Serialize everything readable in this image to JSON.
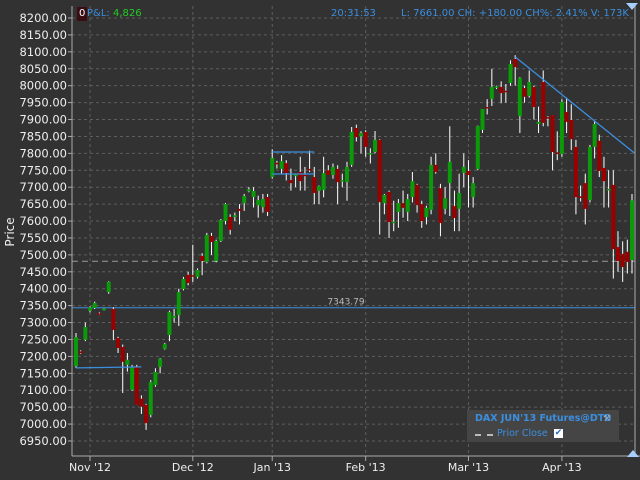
{
  "header": {
    "account_badge": "0",
    "pnl_label": "P&L:",
    "pnl_value": "4,826",
    "time": "20:31:53",
    "stats": "L: 7661.00 CH: +180.00 CH%: 2.41% V: 173K"
  },
  "legend": {
    "instrument": "DAX JUN'13 Futures@DTB",
    "prior_close_label": "Prior Close",
    "prior_close_checked": true
  },
  "colors": {
    "up": "#0a9a0a",
    "down": "#9a0000",
    "wick": "#ffffff",
    "line": "#3a8fe0",
    "background": "#323232",
    "accent_text": "#3a8fe0",
    "pnl": "#22cc22"
  },
  "chart_data": {
    "type": "candlestick",
    "ylabel": "Price",
    "ylim": [
      6925,
      8225
    ],
    "y_ticks": [
      "6950.00",
      "7000.00",
      "7050.00",
      "7100.00",
      "7150.00",
      "7200.00",
      "7250.00",
      "7300.00",
      "7350.00",
      "7400.00",
      "7450.00",
      "7500.00",
      "7550.00",
      "7600.00",
      "7650.00",
      "7700.00",
      "7750.00",
      "7800.00",
      "7850.00",
      "7900.00",
      "7950.00",
      "8000.00",
      "8050.00",
      "8100.00",
      "8150.00",
      "8200.00"
    ],
    "x_ticks": [
      {
        "label": "Nov '12",
        "at": 3
      },
      {
        "label": "Dec '12",
        "at": 25
      },
      {
        "label": "Jan '13",
        "at": 42
      },
      {
        "label": "Feb '13",
        "at": 62
      },
      {
        "label": "Mar '13",
        "at": 84
      },
      {
        "label": "Apr '13",
        "at": 104
      }
    ],
    "grid": true,
    "ohlc": [
      [
        7171,
        7269,
        7166,
        7257
      ],
      [
        7215,
        7218,
        7208,
        7210
      ],
      [
        7249,
        7300,
        7245,
        7287
      ],
      [
        7335,
        7348,
        7330,
        7345
      ],
      [
        7343,
        7362,
        7340,
        7358
      ],
      [
        7327,
        7330,
        7322,
        7324
      ],
      [
        7338,
        7342,
        7336,
        7341
      ],
      [
        7390,
        7422,
        7385,
        7420
      ],
      [
        7340,
        7345,
        7248,
        7278
      ],
      [
        7254,
        7258,
        7210,
        7225
      ],
      [
        7228,
        7235,
        7092,
        7184
      ],
      [
        7175,
        7210,
        7155,
        7190
      ],
      [
        7101,
        7175,
        7098,
        7169
      ],
      [
        7169,
        7175,
        7057,
        7057
      ],
      [
        7075,
        7085,
        7030,
        7051
      ],
      [
        7057,
        7060,
        6983,
        7003
      ],
      [
        7027,
        7130,
        7020,
        7124
      ],
      [
        7115,
        7165,
        7110,
        7154
      ],
      [
        7169,
        7195,
        7150,
        7193
      ],
      [
        7222,
        7240,
        7220,
        7237
      ],
      [
        7263,
        7335,
        7245,
        7331
      ],
      [
        7314,
        7340,
        7300,
        7320
      ],
      [
        7322,
        7400,
        7290,
        7390
      ],
      [
        7399,
        7435,
        7395,
        7429
      ],
      [
        7441,
        7450,
        7410,
        7417
      ],
      [
        7440,
        7530,
        7420,
        7436
      ],
      [
        7435,
        7460,
        7430,
        7455
      ],
      [
        7497,
        7505,
        7440,
        7482
      ],
      [
        7479,
        7565,
        7475,
        7559
      ],
      [
        7556,
        7565,
        7500,
        7538
      ],
      [
        7482,
        7545,
        7478,
        7541
      ],
      [
        7541,
        7606,
        7538,
        7603
      ],
      [
        7600,
        7653,
        7590,
        7650
      ],
      [
        7612,
        7620,
        7560,
        7574
      ],
      [
        7612,
        7625,
        7600,
        7617
      ],
      [
        7636,
        7650,
        7590,
        7630
      ],
      [
        7653,
        7680,
        7630,
        7674
      ],
      [
        7688,
        7700,
        7685,
        7694
      ],
      [
        7671,
        7700,
        7640,
        7689
      ],
      [
        7647,
        7675,
        7610,
        7662
      ],
      [
        7641,
        7680,
        7625,
        7665
      ],
      [
        7671,
        7680,
        7615,
        7627
      ],
      [
        7730,
        7812,
        7725,
        7786
      ],
      [
        7772,
        7778,
        7755,
        7768
      ],
      [
        7754,
        7795,
        7740,
        7777
      ],
      [
        7771,
        7780,
        7720,
        7742
      ],
      [
        7721,
        7755,
        7690,
        7712
      ],
      [
        7733,
        7740,
        7700,
        7737
      ],
      [
        7745,
        7790,
        7690,
        7718
      ],
      [
        7737,
        7760,
        7690,
        7733
      ],
      [
        7754,
        7808,
        7745,
        7751
      ],
      [
        7730,
        7760,
        7650,
        7683
      ],
      [
        7689,
        7705,
        7650,
        7703
      ],
      [
        7692,
        7790,
        7670,
        7742
      ],
      [
        7750,
        7765,
        7740,
        7736
      ],
      [
        7736,
        7770,
        7725,
        7760
      ],
      [
        7754,
        7765,
        7650,
        7715
      ],
      [
        7718,
        7740,
        7700,
        7721
      ],
      [
        7715,
        7775,
        7660,
        7760
      ],
      [
        7766,
        7878,
        7760,
        7863
      ],
      [
        7875,
        7885,
        7835,
        7848
      ],
      [
        7850,
        7865,
        7800,
        7860
      ],
      [
        7863,
        7868,
        7790,
        7819
      ],
      [
        7798,
        7815,
        7770,
        7801
      ],
      [
        7804,
        7866,
        7800,
        7840
      ],
      [
        7840,
        7842,
        7560,
        7656
      ],
      [
        7653,
        7680,
        7620,
        7677
      ],
      [
        7686,
        7690,
        7550,
        7597
      ],
      [
        7595,
        7660,
        7570,
        7598
      ],
      [
        7627,
        7665,
        7580,
        7653
      ],
      [
        7653,
        7690,
        7610,
        7639
      ],
      [
        7627,
        7680,
        7600,
        7665
      ],
      [
        7671,
        7745,
        7655,
        7718
      ],
      [
        7707,
        7710,
        7625,
        7647
      ],
      [
        7650,
        7660,
        7580,
        7600
      ],
      [
        7612,
        7645,
        7590,
        7639
      ],
      [
        7633,
        7790,
        7620,
        7766
      ],
      [
        7766,
        7800,
        7740,
        7745
      ],
      [
        7697,
        7710,
        7555,
        7594
      ],
      [
        7636,
        7700,
        7620,
        7668
      ],
      [
        7712,
        7880,
        7615,
        7775
      ],
      [
        7644,
        7690,
        7570,
        7609
      ],
      [
        7636,
        7740,
        7570,
        7683
      ],
      [
        7742,
        7800,
        7700,
        7760
      ],
      [
        7748,
        7780,
        7640,
        7736
      ],
      [
        7671,
        7730,
        7640,
        7712
      ],
      [
        7754,
        7882,
        7750,
        7881
      ],
      [
        7869,
        7931,
        7860,
        7931
      ],
      [
        7937,
        7960,
        7915,
        7935
      ],
      [
        7961,
        8050,
        7940,
        7996
      ],
      [
        7994,
        8000,
        7990,
        7998
      ],
      [
        7996,
        8013,
        7948,
        7978
      ],
      [
        7985,
        8005,
        7950,
        7982
      ],
      [
        8008,
        8075,
        8000,
        8064
      ],
      [
        8079,
        8090,
        8000,
        8055
      ],
      [
        7910,
        8025,
        7860,
        8023
      ],
      [
        7993,
        8000,
        7950,
        7967
      ],
      [
        7970,
        8045,
        7965,
        8011
      ],
      [
        7996,
        8000,
        7900,
        7937
      ],
      [
        7887,
        7938,
        7860,
        7893
      ],
      [
        8011,
        8045,
        7880,
        7890
      ],
      [
        7907,
        7910,
        7880,
        7903
      ],
      [
        7913,
        7913,
        7750,
        7804
      ],
      [
        7803,
        7865,
        7780,
        7798
      ],
      [
        7798,
        7960,
        7790,
        7952
      ],
      [
        7922,
        7965,
        7860,
        7893
      ],
      [
        7899,
        7945,
        7810,
        7842
      ],
      [
        7819,
        7840,
        7620,
        7671
      ],
      [
        7673,
        7705,
        7658,
        7668
      ],
      [
        7712,
        7740,
        7590,
        7636
      ],
      [
        7662,
        7825,
        7655,
        7819
      ],
      [
        7819,
        7895,
        7785,
        7887
      ],
      [
        7837,
        7855,
        7730,
        7748
      ],
      [
        7757,
        7790,
        7640,
        7718
      ],
      [
        7692,
        7750,
        7640,
        7695
      ],
      [
        7707,
        7750,
        7430,
        7517
      ],
      [
        7523,
        7570,
        7450,
        7482
      ],
      [
        7503,
        7540,
        7420,
        7464
      ],
      [
        7509,
        7545,
        7445,
        7479
      ],
      [
        7485,
        7680,
        7445,
        7661
      ]
    ],
    "prior_close": 7481,
    "horizontal_line": {
      "value": 7343.79,
      "label": "7343.79"
    },
    "drawn_lines": [
      {
        "from": [
          0,
          7166
        ],
        "to": [
          14,
          7169
        ]
      },
      {
        "from": [
          42,
          7804
        ],
        "to": [
          51,
          7804
        ]
      },
      {
        "from": [
          42,
          7739
        ],
        "to": [
          51,
          7739
        ]
      },
      {
        "from": [
          94,
          8085
        ],
        "to": [
          119.5,
          7801
        ]
      }
    ]
  }
}
